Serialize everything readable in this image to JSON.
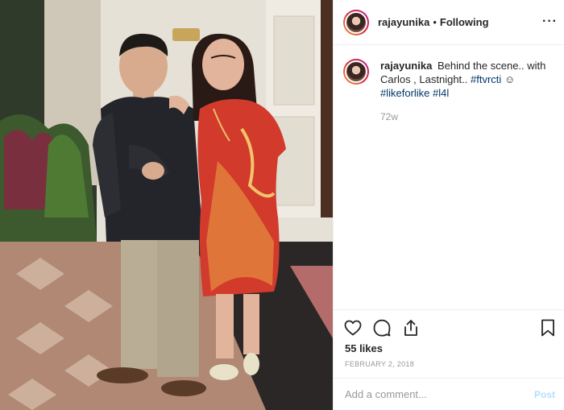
{
  "post": {
    "username": "rajayunika",
    "separator": "•",
    "follow_status": "Following",
    "more_label": "···",
    "caption": {
      "username": "rajayunika",
      "text_1": "Behind the scene.. with Carlos , Lastnight..",
      "hashtag_1": "#ftvrcti",
      "emoji": "☺",
      "hashtag_2": "#likeforlike",
      "hashtag_3": "#l4l"
    },
    "time_ago": "72w",
    "likes": "55 likes",
    "date": "FEBRUARY 2, 2018",
    "comment_placeholder": "Add a comment...",
    "post_button": "Post"
  },
  "icons": {
    "like": "heart-icon",
    "comment": "comment-icon",
    "share": "share-icon",
    "save": "bookmark-icon",
    "more": "more-icon"
  },
  "colors": {
    "text": "#262626",
    "muted": "#999999",
    "link": "#003569",
    "border": "#efefef",
    "post_disabled": "#b2dffc"
  }
}
